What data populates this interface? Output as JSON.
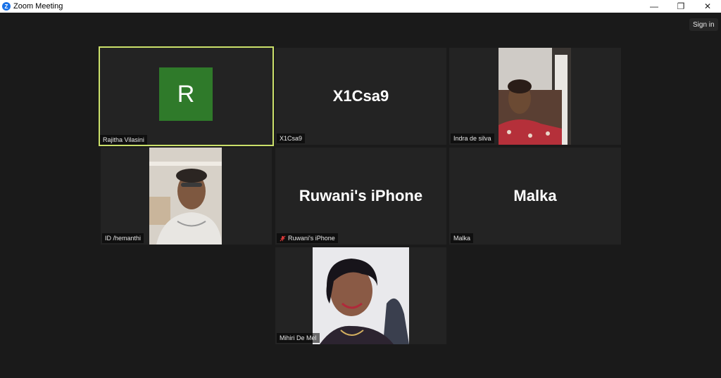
{
  "window": {
    "title": "Zoom Meeting",
    "logo_letter": "Z",
    "minimize": "—",
    "restore": "❐",
    "close": "✕"
  },
  "header": {
    "sign_in": "Sign in"
  },
  "colors": {
    "background": "#1a1a1a",
    "tile": "#232323",
    "active_border": "#cbe06a",
    "avatar_green": "#2f7a2a",
    "mute_red": "#e23b3b"
  },
  "participants": [
    {
      "name": "Rajitha Vilasini",
      "initial": "R",
      "active_speaker": true,
      "video": false
    },
    {
      "name": "X1Csa9",
      "display": "X1Csa9",
      "video": false
    },
    {
      "name": "Indra de silva",
      "video": true
    },
    {
      "name": "ID /hemanthi",
      "video": true
    },
    {
      "name": "Ruwani's iPhone",
      "display": "Ruwani's iPhone",
      "muted": true,
      "video": false
    },
    {
      "name": "Malka",
      "display": "Malka",
      "video": false
    },
    {
      "name": "Mihiri De Mel",
      "video": true
    }
  ]
}
